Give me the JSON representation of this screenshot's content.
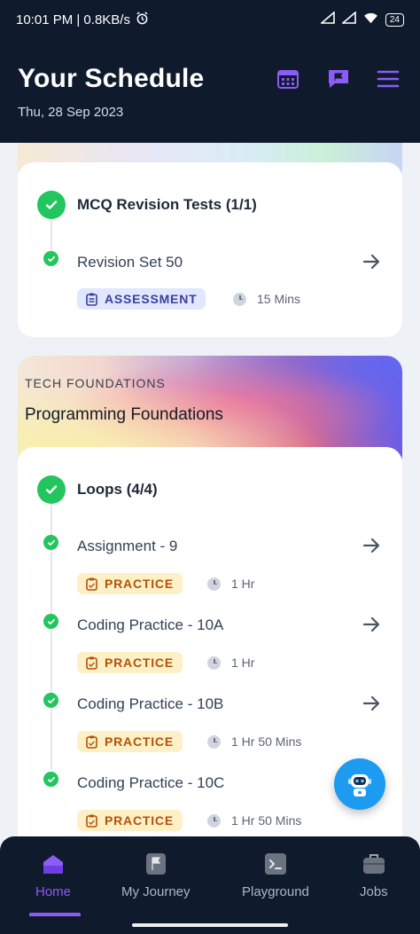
{
  "status_bar": {
    "time_speed": "10:01 PM | 0.8KB/s",
    "battery": "24"
  },
  "header": {
    "title": "Your Schedule",
    "date": "Thu, 28 Sep 2023",
    "icons": [
      "calendar-icon",
      "chat-flag-icon",
      "menu-icon"
    ]
  },
  "mcq_card": {
    "section_title": "MCQ Revision Tests (1/1)",
    "items": [
      {
        "title": "Revision Set 50",
        "badge": "ASSESSMENT",
        "duration": "15 Mins"
      }
    ]
  },
  "course_banner": {
    "kicker": "TECH FOUNDATIONS",
    "title": "Programming Foundations"
  },
  "loops_card": {
    "section_title": "Loops (4/4)",
    "items": [
      {
        "title": "Assignment - 9",
        "badge": "PRACTICE",
        "duration": "1 Hr"
      },
      {
        "title": "Coding Practice - 10A",
        "badge": "PRACTICE",
        "duration": "1 Hr"
      },
      {
        "title": "Coding Practice - 10B",
        "badge": "PRACTICE",
        "duration": "1 Hr 50 Mins"
      },
      {
        "title": "Coding Practice - 10C",
        "badge": "PRACTICE",
        "duration": "1 Hr 50 Mins"
      }
    ]
  },
  "bottom_nav": {
    "items": [
      {
        "label": "Home",
        "active": true
      },
      {
        "label": "My Journey",
        "active": false
      },
      {
        "label": "Playground",
        "active": false
      },
      {
        "label": "Jobs",
        "active": false
      }
    ]
  },
  "colors": {
    "header_bg": "#0f1a2d",
    "accent": "#8b5cf6",
    "success": "#22c55e",
    "assessment_badge_bg": "#e0e7ff",
    "practice_badge_bg": "#fdf0c7"
  }
}
